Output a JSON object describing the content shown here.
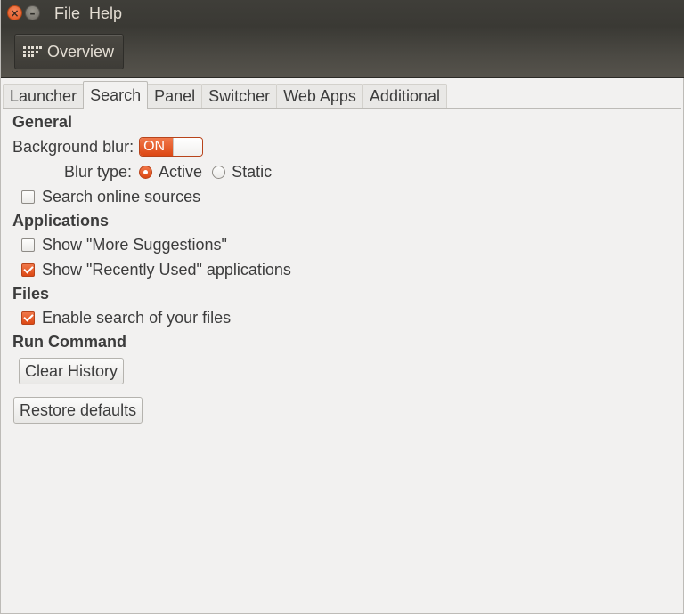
{
  "titlebar": {
    "menu": [
      "File",
      "Help"
    ]
  },
  "toolbar": {
    "overview_label": "Overview"
  },
  "tabs": [
    {
      "label": "Launcher",
      "active": false
    },
    {
      "label": "Search",
      "active": true
    },
    {
      "label": "Panel",
      "active": false
    },
    {
      "label": "Switcher",
      "active": false
    },
    {
      "label": "Web Apps",
      "active": false
    },
    {
      "label": "Additional",
      "active": false
    }
  ],
  "general": {
    "heading": "General",
    "background_blur_label": "Background blur:",
    "background_blur_switch": "ON",
    "blur_type_label": "Blur type:",
    "blur_type_options": [
      "Active",
      "Static"
    ],
    "blur_type_selected": "Active",
    "search_online_label": "Search online sources",
    "search_online_checked": false
  },
  "applications": {
    "heading": "Applications",
    "more_suggestions_label": "Show \"More Suggestions\"",
    "more_suggestions_checked": false,
    "recently_used_label": "Show \"Recently Used\" applications",
    "recently_used_checked": true
  },
  "files": {
    "heading": "Files",
    "enable_search_label": "Enable search of your files",
    "enable_search_checked": true
  },
  "run_command": {
    "heading": "Run Command",
    "clear_history_label": "Clear History"
  },
  "restore_defaults_label": "Restore defaults",
  "colors": {
    "accent": "#dd4814",
    "titlebar": "#3c3b37",
    "background": "#f2f1f0"
  }
}
